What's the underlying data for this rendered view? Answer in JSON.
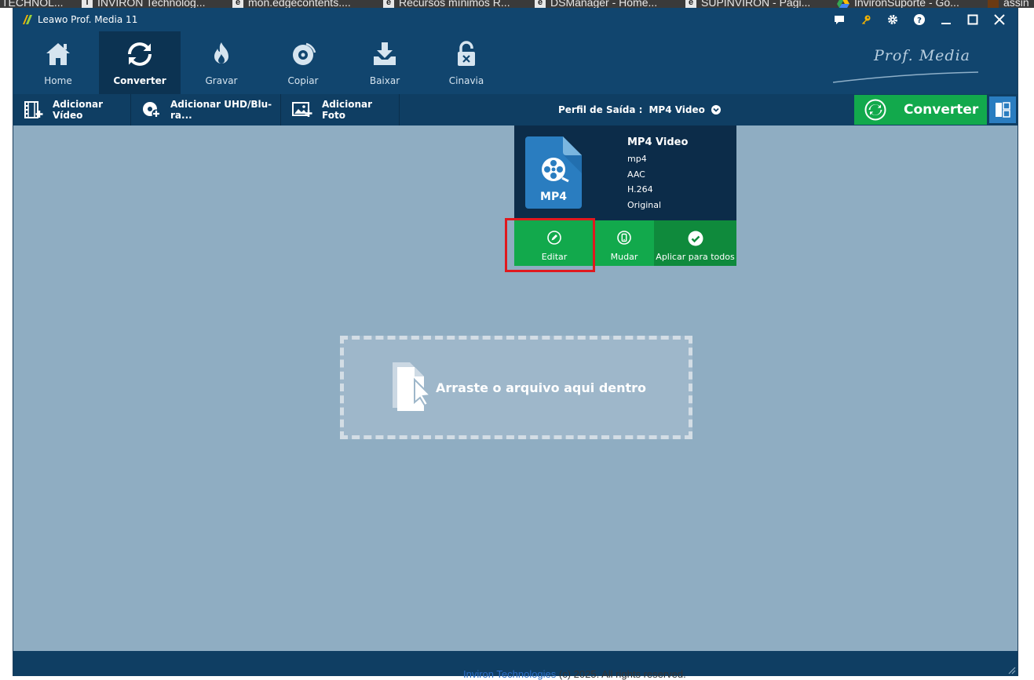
{
  "browser_bookmarks": [
    {
      "label": "TECHNOL...",
      "icon": ""
    },
    {
      "label": "INVIRON Technolog...",
      "icon": "I"
    },
    {
      "label": "mon.edgecontents....",
      "icon": "e"
    },
    {
      "label": "Recursos mínimos R...",
      "icon": "e"
    },
    {
      "label": "DSManager - Home...",
      "icon": "e"
    },
    {
      "label": "SUPINVIRON - Pági...",
      "icon": "e"
    },
    {
      "label": "InvironSuporte - Go...",
      "icon": "drive"
    },
    {
      "label": "assin",
      "icon": ""
    }
  ],
  "window": {
    "title": "Leawo Prof. Media 11"
  },
  "nav": {
    "items": [
      {
        "label": "Home",
        "icon": "home-icon"
      },
      {
        "label": "Converter",
        "icon": "convert-icon",
        "active": true
      },
      {
        "label": "Gravar",
        "icon": "burn-icon"
      },
      {
        "label": "Copiar",
        "icon": "disc-copy-icon"
      },
      {
        "label": "Baixar",
        "icon": "download-icon"
      },
      {
        "label": "Cinavia",
        "icon": "unlock-icon"
      }
    ],
    "brand": "Prof. Media"
  },
  "toolbar": {
    "add_video": "Adicionar Vídeo",
    "add_uhd": "Adicionar UHD/Blu-ra...",
    "add_photo": "Adicionar Foto",
    "profile_label": "Perfil de Saída :",
    "profile_value": "MP4 Video",
    "convert": "Converter"
  },
  "profile_popup": {
    "icon_text": "MP4",
    "name": "MP4 Video",
    "details": [
      "mp4",
      "AAC",
      "H.264",
      "Original"
    ],
    "buttons": {
      "edit": "Editar",
      "change": "Mudar",
      "apply_all": "Aplicar para todos"
    }
  },
  "dropzone": {
    "text": "Arraste o arquivo aqui dentro"
  },
  "behind_footer": {
    "link": "Inviron Technologies",
    "text": " (c) 2025. All rights reserved."
  },
  "colors": {
    "nav_bg": "#11456e",
    "content_bg": "#8fadc2",
    "accent_green": "#12a94c",
    "highlight_red": "#e0191e"
  }
}
